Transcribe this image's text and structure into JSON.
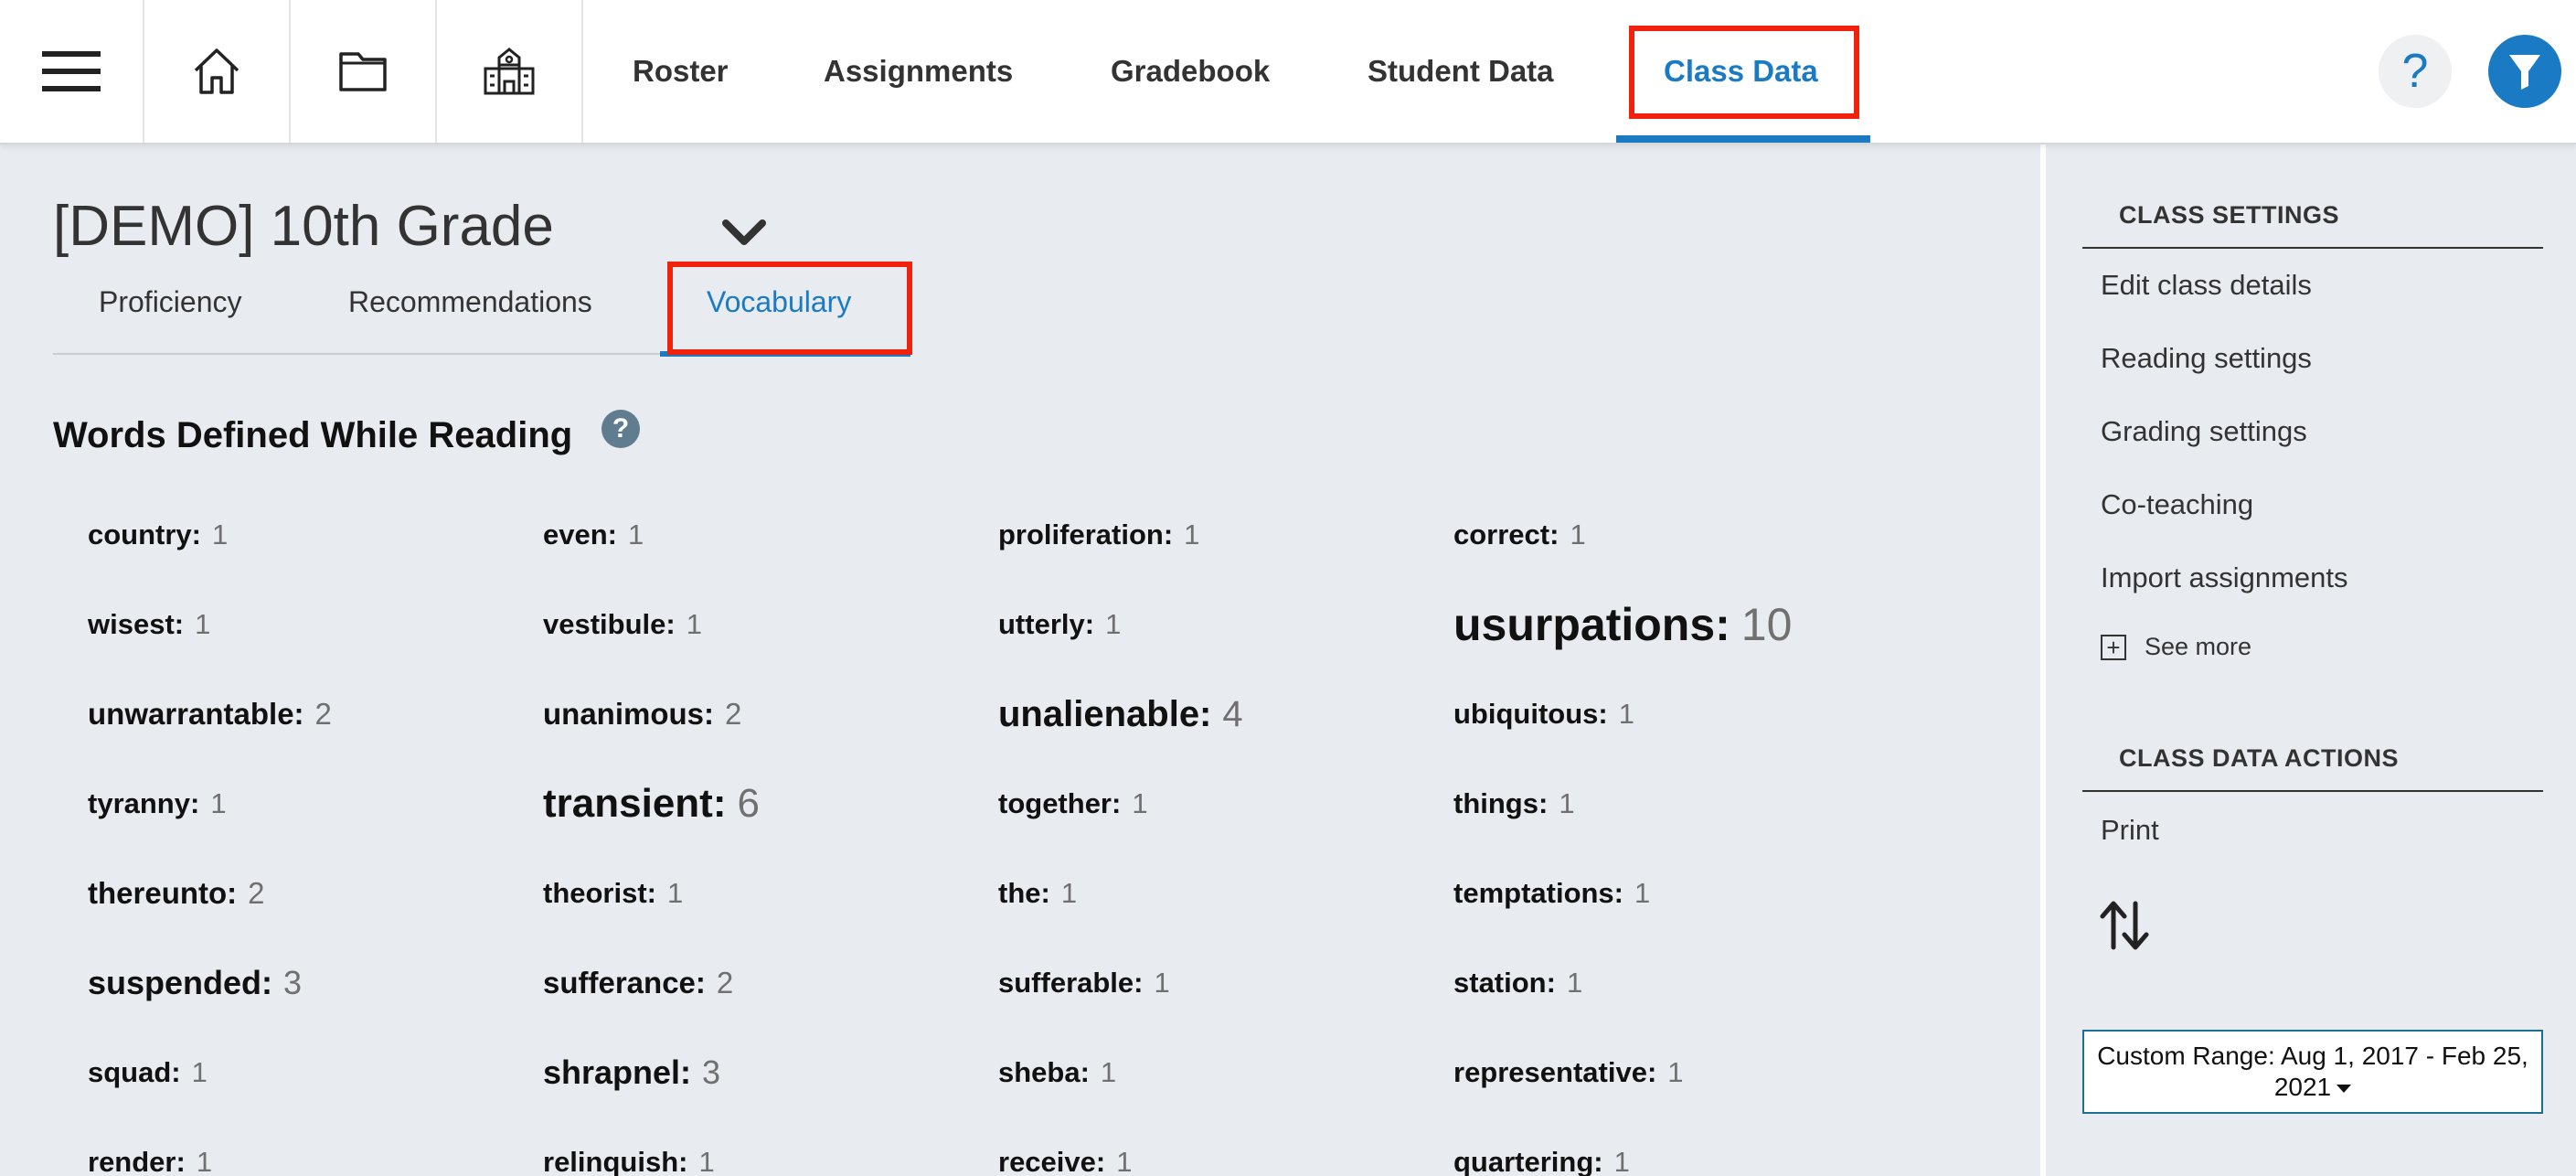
{
  "nav": {
    "icons": [
      "menu-icon",
      "home-icon",
      "folder-icon",
      "school-icon"
    ],
    "links": [
      "Roster",
      "Assignments",
      "Gradebook",
      "Student Data",
      "Class Data"
    ],
    "active": "Class Data",
    "help_label": "?"
  },
  "class": {
    "title": "[DEMO] 10th Grade"
  },
  "subtabs": [
    "Proficiency",
    "Recommendations",
    "Vocabulary"
  ],
  "active_subtab": "Vocabulary",
  "section": {
    "title": "Words Defined While Reading",
    "help_label": "?"
  },
  "words": [
    {
      "word": "country:",
      "count": "1"
    },
    {
      "word": "even:",
      "count": "1"
    },
    {
      "word": "proliferation:",
      "count": "1"
    },
    {
      "word": "correct:",
      "count": "1"
    },
    {
      "word": "wisest:",
      "count": "1"
    },
    {
      "word": "vestibule:",
      "count": "1"
    },
    {
      "word": "utterly:",
      "count": "1"
    },
    {
      "word": "usurpations:",
      "count": "10"
    },
    {
      "word": "unwarrantable:",
      "count": "2"
    },
    {
      "word": "unanimous:",
      "count": "2"
    },
    {
      "word": "unalienable:",
      "count": "4"
    },
    {
      "word": "ubiquitous:",
      "count": "1"
    },
    {
      "word": "tyranny:",
      "count": "1"
    },
    {
      "word": "transient:",
      "count": "6"
    },
    {
      "word": "together:",
      "count": "1"
    },
    {
      "word": "things:",
      "count": "1"
    },
    {
      "word": "thereunto:",
      "count": "2"
    },
    {
      "word": "theorist:",
      "count": "1"
    },
    {
      "word": "the:",
      "count": "1"
    },
    {
      "word": "temptations:",
      "count": "1"
    },
    {
      "word": "suspended:",
      "count": "3"
    },
    {
      "word": "sufferance:",
      "count": "2"
    },
    {
      "word": "sufferable:",
      "count": "1"
    },
    {
      "word": "station:",
      "count": "1"
    },
    {
      "word": "squad:",
      "count": "1"
    },
    {
      "word": "shrapnel:",
      "count": "3"
    },
    {
      "word": "sheba:",
      "count": "1"
    },
    {
      "word": "representative:",
      "count": "1"
    },
    {
      "word": "render:",
      "count": "1"
    },
    {
      "word": "relinquish:",
      "count": "1"
    },
    {
      "word": "receive:",
      "count": "1"
    },
    {
      "word": "quartering:",
      "count": "1"
    }
  ],
  "sidebar": {
    "settings_heading": "CLASS SETTINGS",
    "settings_links": [
      "Edit class details",
      "Reading settings",
      "Grading settings",
      "Co-teaching",
      "Import assignments"
    ],
    "see_more": "See more",
    "actions_heading": "CLASS DATA ACTIONS",
    "print": "Print",
    "sort_icon": "sort-arrows-icon",
    "date_range": "Custom Range: Aug 1, 2017 - Feb 25, 2021"
  },
  "colors": {
    "accent": "#1a7bc4",
    "highlight": "#f0220e",
    "background": "#e8ecf0"
  }
}
